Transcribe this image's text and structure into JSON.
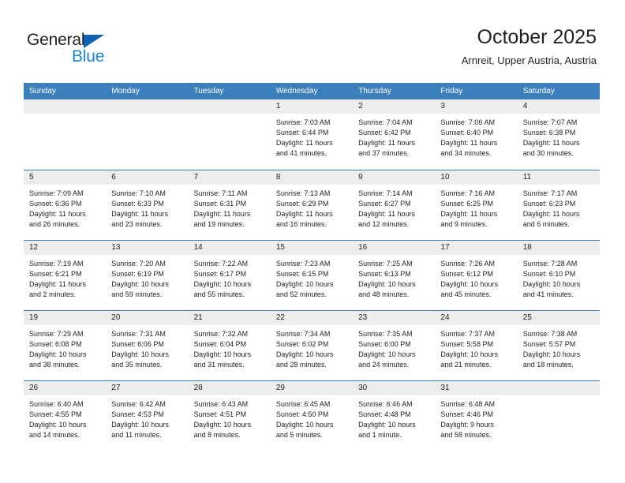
{
  "brand": {
    "name_part1": "General",
    "name_part2": "Blue",
    "accent_color": "#1b86d6",
    "triangle_color": "#0b63b1"
  },
  "header": {
    "title": "October 2025",
    "subtitle": "Arnreit, Upper Austria, Austria"
  },
  "calendar": {
    "header_color": "#3c7fbd",
    "weekdays": [
      "Sunday",
      "Monday",
      "Tuesday",
      "Wednesday",
      "Thursday",
      "Friday",
      "Saturday"
    ],
    "weeks": [
      [
        {
          "day": "",
          "sunrise": "",
          "sunset": "",
          "daylight": "",
          "daylight2": "",
          "empty": true
        },
        {
          "day": "",
          "sunrise": "",
          "sunset": "",
          "daylight": "",
          "daylight2": "",
          "empty": true
        },
        {
          "day": "",
          "sunrise": "",
          "sunset": "",
          "daylight": "",
          "daylight2": "",
          "empty": true
        },
        {
          "day": "1",
          "sunrise": "Sunrise: 7:03 AM",
          "sunset": "Sunset: 6:44 PM",
          "daylight": "Daylight: 11 hours",
          "daylight2": "and 41 minutes."
        },
        {
          "day": "2",
          "sunrise": "Sunrise: 7:04 AM",
          "sunset": "Sunset: 6:42 PM",
          "daylight": "Daylight: 11 hours",
          "daylight2": "and 37 minutes."
        },
        {
          "day": "3",
          "sunrise": "Sunrise: 7:06 AM",
          "sunset": "Sunset: 6:40 PM",
          "daylight": "Daylight: 11 hours",
          "daylight2": "and 34 minutes."
        },
        {
          "day": "4",
          "sunrise": "Sunrise: 7:07 AM",
          "sunset": "Sunset: 6:38 PM",
          "daylight": "Daylight: 11 hours",
          "daylight2": "and 30 minutes."
        }
      ],
      [
        {
          "day": "5",
          "sunrise": "Sunrise: 7:09 AM",
          "sunset": "Sunset: 6:36 PM",
          "daylight": "Daylight: 11 hours",
          "daylight2": "and 26 minutes."
        },
        {
          "day": "6",
          "sunrise": "Sunrise: 7:10 AM",
          "sunset": "Sunset: 6:33 PM",
          "daylight": "Daylight: 11 hours",
          "daylight2": "and 23 minutes."
        },
        {
          "day": "7",
          "sunrise": "Sunrise: 7:11 AM",
          "sunset": "Sunset: 6:31 PM",
          "daylight": "Daylight: 11 hours",
          "daylight2": "and 19 minutes."
        },
        {
          "day": "8",
          "sunrise": "Sunrise: 7:13 AM",
          "sunset": "Sunset: 6:29 PM",
          "daylight": "Daylight: 11 hours",
          "daylight2": "and 16 minutes."
        },
        {
          "day": "9",
          "sunrise": "Sunrise: 7:14 AM",
          "sunset": "Sunset: 6:27 PM",
          "daylight": "Daylight: 11 hours",
          "daylight2": "and 12 minutes."
        },
        {
          "day": "10",
          "sunrise": "Sunrise: 7:16 AM",
          "sunset": "Sunset: 6:25 PM",
          "daylight": "Daylight: 11 hours",
          "daylight2": "and 9 minutes."
        },
        {
          "day": "11",
          "sunrise": "Sunrise: 7:17 AM",
          "sunset": "Sunset: 6:23 PM",
          "daylight": "Daylight: 11 hours",
          "daylight2": "and 6 minutes."
        }
      ],
      [
        {
          "day": "12",
          "sunrise": "Sunrise: 7:19 AM",
          "sunset": "Sunset: 6:21 PM",
          "daylight": "Daylight: 11 hours",
          "daylight2": "and 2 minutes."
        },
        {
          "day": "13",
          "sunrise": "Sunrise: 7:20 AM",
          "sunset": "Sunset: 6:19 PM",
          "daylight": "Daylight: 10 hours",
          "daylight2": "and 59 minutes."
        },
        {
          "day": "14",
          "sunrise": "Sunrise: 7:22 AM",
          "sunset": "Sunset: 6:17 PM",
          "daylight": "Daylight: 10 hours",
          "daylight2": "and 55 minutes."
        },
        {
          "day": "15",
          "sunrise": "Sunrise: 7:23 AM",
          "sunset": "Sunset: 6:15 PM",
          "daylight": "Daylight: 10 hours",
          "daylight2": "and 52 minutes."
        },
        {
          "day": "16",
          "sunrise": "Sunrise: 7:25 AM",
          "sunset": "Sunset: 6:13 PM",
          "daylight": "Daylight: 10 hours",
          "daylight2": "and 48 minutes."
        },
        {
          "day": "17",
          "sunrise": "Sunrise: 7:26 AM",
          "sunset": "Sunset: 6:12 PM",
          "daylight": "Daylight: 10 hours",
          "daylight2": "and 45 minutes."
        },
        {
          "day": "18",
          "sunrise": "Sunrise: 7:28 AM",
          "sunset": "Sunset: 6:10 PM",
          "daylight": "Daylight: 10 hours",
          "daylight2": "and 41 minutes."
        }
      ],
      [
        {
          "day": "19",
          "sunrise": "Sunrise: 7:29 AM",
          "sunset": "Sunset: 6:08 PM",
          "daylight": "Daylight: 10 hours",
          "daylight2": "and 38 minutes."
        },
        {
          "day": "20",
          "sunrise": "Sunrise: 7:31 AM",
          "sunset": "Sunset: 6:06 PM",
          "daylight": "Daylight: 10 hours",
          "daylight2": "and 35 minutes."
        },
        {
          "day": "21",
          "sunrise": "Sunrise: 7:32 AM",
          "sunset": "Sunset: 6:04 PM",
          "daylight": "Daylight: 10 hours",
          "daylight2": "and 31 minutes."
        },
        {
          "day": "22",
          "sunrise": "Sunrise: 7:34 AM",
          "sunset": "Sunset: 6:02 PM",
          "daylight": "Daylight: 10 hours",
          "daylight2": "and 28 minutes."
        },
        {
          "day": "23",
          "sunrise": "Sunrise: 7:35 AM",
          "sunset": "Sunset: 6:00 PM",
          "daylight": "Daylight: 10 hours",
          "daylight2": "and 24 minutes."
        },
        {
          "day": "24",
          "sunrise": "Sunrise: 7:37 AM",
          "sunset": "Sunset: 5:58 PM",
          "daylight": "Daylight: 10 hours",
          "daylight2": "and 21 minutes."
        },
        {
          "day": "25",
          "sunrise": "Sunrise: 7:38 AM",
          "sunset": "Sunset: 5:57 PM",
          "daylight": "Daylight: 10 hours",
          "daylight2": "and 18 minutes."
        }
      ],
      [
        {
          "day": "26",
          "sunrise": "Sunrise: 6:40 AM",
          "sunset": "Sunset: 4:55 PM",
          "daylight": "Daylight: 10 hours",
          "daylight2": "and 14 minutes."
        },
        {
          "day": "27",
          "sunrise": "Sunrise: 6:42 AM",
          "sunset": "Sunset: 4:53 PM",
          "daylight": "Daylight: 10 hours",
          "daylight2": "and 11 minutes."
        },
        {
          "day": "28",
          "sunrise": "Sunrise: 6:43 AM",
          "sunset": "Sunset: 4:51 PM",
          "daylight": "Daylight: 10 hours",
          "daylight2": "and 8 minutes."
        },
        {
          "day": "29",
          "sunrise": "Sunrise: 6:45 AM",
          "sunset": "Sunset: 4:50 PM",
          "daylight": "Daylight: 10 hours",
          "daylight2": "and 5 minutes."
        },
        {
          "day": "30",
          "sunrise": "Sunrise: 6:46 AM",
          "sunset": "Sunset: 4:48 PM",
          "daylight": "Daylight: 10 hours",
          "daylight2": "and 1 minute."
        },
        {
          "day": "31",
          "sunrise": "Sunrise: 6:48 AM",
          "sunset": "Sunset: 4:46 PM",
          "daylight": "Daylight: 9 hours",
          "daylight2": "and 58 minutes."
        },
        {
          "day": "",
          "sunrise": "",
          "sunset": "",
          "daylight": "",
          "daylight2": "",
          "empty": true
        }
      ]
    ]
  }
}
